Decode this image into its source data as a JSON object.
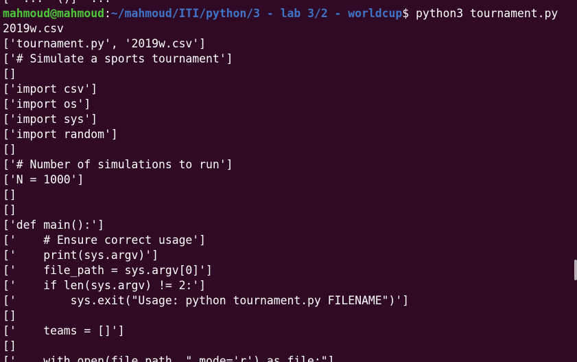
{
  "prompt": {
    "user_host": "mahmoud@mahmoud",
    "separator": ":",
    "cwd": "~/mahmoud/ITI/python/3 - lab 3/2 - worldcup",
    "symbol": "$ ",
    "command": "python3 tournament.py"
  },
  "output_lines": [
    "[  ...  ()]  ...",
    "2019w.csv",
    "['tournament.py', '2019w.csv']",
    "['# Simulate a sports tournament']",
    "[]",
    "['import csv']",
    "['import os']",
    "['import sys']",
    "['import random']",
    "[]",
    "['# Number of simulations to run']",
    "['N = 1000']",
    "[]",
    "[]",
    "['def main():']",
    "['    # Ensure correct usage']",
    "['    print(sys.argv)']",
    "['    file_path = sys.argv[0]']",
    "['    if len(sys.argv) != 2:']",
    "['        sys.exit(\"Usage: python tournament.py FILENAME\")']",
    "[]",
    "['    teams = []']",
    "[]",
    "['    with open(file_path, \"_mode='r') as file:\"]"
  ]
}
